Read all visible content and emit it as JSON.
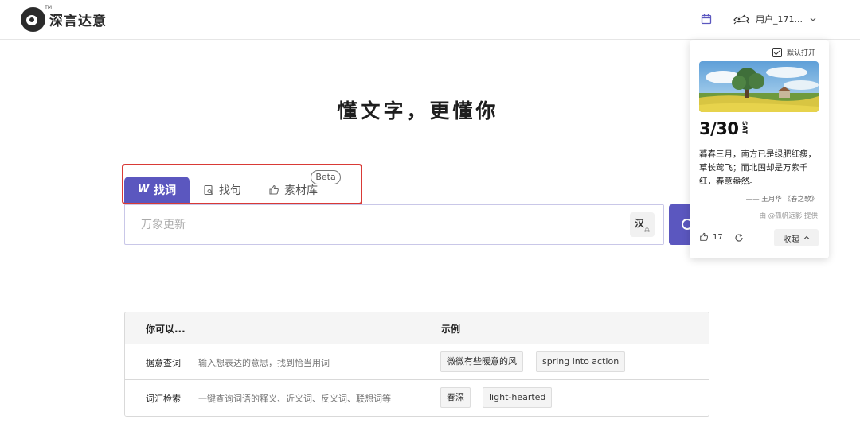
{
  "header": {
    "logo_text": "深言达意",
    "logo_tm": "TM",
    "user_name": "用户_171...",
    "icons": [
      "calendar-icon",
      "user-avatar-icon",
      "chevron-down-icon"
    ]
  },
  "headline": "懂文字，更懂你",
  "tabs": [
    {
      "label": "找词",
      "icon_text": "W",
      "active": true
    },
    {
      "label": "找句",
      "active": false
    },
    {
      "label": "素材库",
      "active": false,
      "badge": "Beta"
    }
  ],
  "search": {
    "placeholder": "万象更新",
    "lang_toggle_primary": "汉",
    "lang_toggle_secondary": "英"
  },
  "guide": {
    "col1_header": "你可以...",
    "col2_header": "示例",
    "rows": [
      {
        "title": "据意查词",
        "desc": "输入想表达的意思，找到恰当用词",
        "examples": [
          "微微有些暖意的风",
          "spring into action"
        ]
      },
      {
        "title": "词汇检索",
        "desc": "一键查询词语的释义、近义词、反义词、联想词等",
        "examples": [
          "春深",
          "light-hearted"
        ]
      }
    ]
  },
  "daily_card": {
    "auto_open_label": "默认打开",
    "auto_open_checked": true,
    "date": "3/30",
    "weekday": "SAT",
    "quote": "暮春三月，南方已是绿肥红瘦，草长莺飞；而北国却是万紫千红，春意盎然。",
    "source": "—— 王月华 《春之歌》",
    "credit": "由 @孤帆远影 提供",
    "likes": "17",
    "collapse_label": "收起"
  },
  "colors": {
    "accent": "#5b57bf",
    "highlight_border": "#d93a36"
  }
}
